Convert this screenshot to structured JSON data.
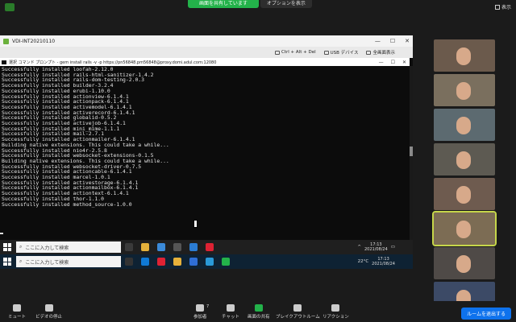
{
  "zoom_banner": {
    "sharing_text": "画面を共有しています",
    "options_label": "オプションを表示"
  },
  "zoom_view": {
    "label": "表示"
  },
  "vdi": {
    "title": "VDI-INT20210110",
    "toolbar": [
      {
        "label": "Ctrl + Alt + Del",
        "icon": "keyboard-icon"
      },
      {
        "label": "USB デバイス",
        "icon": "usb-icon"
      },
      {
        "label": "全画面表示",
        "icon": "fullscreen-icon"
      }
    ]
  },
  "cmd": {
    "title": "選択 コマンド プロンプト - gem install rails -v -p https://pn56848.pm56848@proxy.domi.adul.com:12080",
    "lines": [
      "Successfully installed loofah-2.12.0",
      "Successfully installed rails-html-sanitizer-1.4.2",
      "Successfully installed rails-dom-testing-2.0.3",
      "Successfully installed builder-3.2.4",
      "Successfully installed erubi-1.10.0",
      "Successfully installed actionview-6.1.4.1",
      "Successfully installed actionpack-6.1.4.1",
      "Successfully installed activemodel-6.1.4.1",
      "Successfully installed activerecord-6.1.4.1",
      "Successfully installed globalid-0.5.2",
      "Successfully installed activejob-6.1.4.1",
      "Successfully installed mini_mime-1.1.1",
      "Successfully installed mail-2.7.1",
      "Successfully installed actionmailer-6.1.4.1",
      "Building native extensions. This could take a while...",
      "Successfully installed nio4r-2.5.8",
      "Successfully installed websocket-extensions-0.1.5",
      "Building native extensions. This could take a while...",
      "Successfully installed websocket-driver-0.7.5",
      "Successfully installed actioncable-6.1.4.1",
      "Successfully installed marcel-1.0.1",
      "Successfully installed activestorage-6.1.4.1",
      "Successfully installed actionmailbox-6.1.4.1",
      "Successfully installed actiontext-6.1.4.1",
      "Successfully installed thor-1.1.0",
      "Successfully installed method_source-1.0.0"
    ]
  },
  "taskbar_remote": {
    "search_placeholder": "ここに入力して検索",
    "time": "17:13",
    "date": "2021/08/24"
  },
  "taskbar_local": {
    "search_placeholder": "ここに入力して検索",
    "temperature": "22°C",
    "time": "17:13",
    "date": "2021/08/24"
  },
  "participants": [
    {
      "bg": "#6b5a4c"
    },
    {
      "bg": "#7a6f5e"
    },
    {
      "bg": "#5c6a70"
    },
    {
      "bg": "#5d5a52"
    },
    {
      "bg": "#6e5b4f"
    },
    {
      "bg": "#7c6c54"
    },
    {
      "bg": "#4f4a47"
    },
    {
      "bg": "#3c4a66"
    }
  ],
  "controls": {
    "mute": "ミュート",
    "video": "ビデオの停止",
    "participants": "参加者",
    "participant_count": "7",
    "chat": "チャット",
    "share": "画面の共有",
    "breakout": "ブレイクアウトルーム",
    "reactions": "リアクション",
    "leave": "ルームを退出する"
  },
  "colors": {
    "share_green": "#23b24a",
    "leave_blue": "#0e72ed",
    "active_outline": "#c6d64a"
  }
}
